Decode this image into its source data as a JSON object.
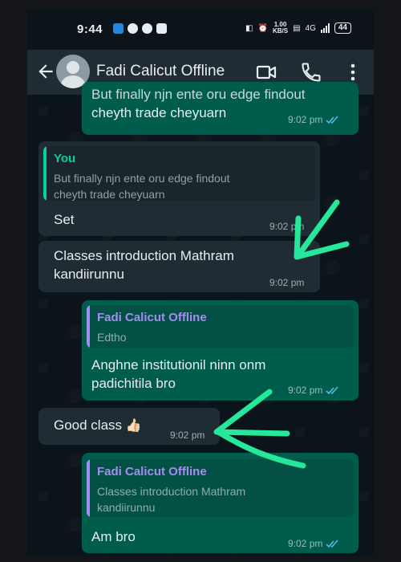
{
  "status_bar": {
    "time": "9:44",
    "speed_value": "1.00",
    "speed_unit": "KB/S",
    "network_label": "4G",
    "battery": "44"
  },
  "header": {
    "contact_name": "Fadi Calicut Offline",
    "icons": [
      "back-arrow-icon",
      "avatar",
      "video-call-icon",
      "voice-call-icon",
      "more-options-icon"
    ]
  },
  "messages": [
    {
      "direction": "outgoing",
      "lines": [
        "But finally njn ente oru edge findout",
        "cheyth trade cheyuarn"
      ],
      "time": "9:02 pm",
      "read": true
    },
    {
      "direction": "incoming",
      "quote": {
        "author": "You",
        "lines": [
          "But finally njn ente oru edge findout",
          "cheyth trade cheyuarn"
        ]
      },
      "lines": [
        "Set"
      ],
      "time": "9:02 pm"
    },
    {
      "direction": "incoming",
      "lines": [
        "Classes introduction Mathram",
        "kandiirunnu"
      ],
      "time": "9:02 pm"
    },
    {
      "direction": "outgoing",
      "quote": {
        "author": "Fadi Calicut Offline",
        "lines": [
          "Edtho"
        ]
      },
      "lines": [
        "Anghne institutionil ninn onm",
        "padichitila bro"
      ],
      "time": "9:02 pm",
      "read": true
    },
    {
      "direction": "incoming",
      "lines": [
        "Good class"
      ],
      "emoji": "👍🏻",
      "time": "9:02 pm"
    },
    {
      "direction": "outgoing",
      "quote": {
        "author": "Fadi Calicut Offline",
        "lines": [
          "Classes introduction Mathram",
          "kandiirunnu"
        ]
      },
      "lines": [
        "Am bro"
      ],
      "time": "9:02 pm",
      "read": true
    }
  ],
  "colors": {
    "outgoing_bubble": "#005c4b",
    "incoming_bubble": "#202c33",
    "header_bg": "#1f2c34",
    "chat_bg": "#0b141a",
    "read_ticks": "#53bdeb",
    "quote_you": "#06cf9c",
    "quote_contact": "#a58cf2",
    "annotation_arrow": "#25e89a"
  }
}
